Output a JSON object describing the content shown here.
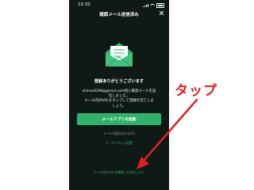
{
  "status_bar": {
    "time": "12:32"
  },
  "header": {
    "title": "確認メール送信済み",
    "close_icon": "close-icon"
  },
  "content": {
    "envelope_icon": "envelope-icon",
    "thanks": "登録ありがとうございます",
    "description_line1": "shinno0290@gmail.com宛に確認メールを送",
    "description_line2": "信しました。",
    "description_line3": "メール内のURLをタップして登録を完了しま",
    "description_line4": "しょう。"
  },
  "actions": {
    "primary_button": "メールアプリを起動",
    "link_not_arrived": "メールが届きませんか?",
    "link_resend": "メールアドレス変更",
    "link_bottom": "メール内のURLを確認したのはこちら"
  },
  "annotation": {
    "label": "タップ"
  },
  "colors": {
    "background": "#0f1a17",
    "accent": "#2fb36b",
    "annotation": "#e02020"
  }
}
